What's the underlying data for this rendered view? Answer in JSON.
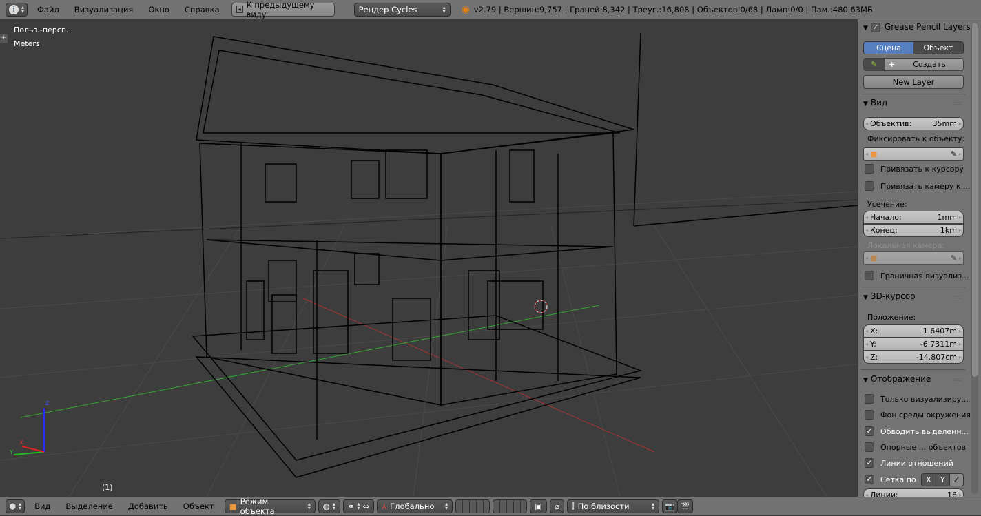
{
  "top": {
    "info_icon": "info-icon",
    "menus": [
      "Файл",
      "Визуализация",
      "Окно",
      "Справка"
    ],
    "back_button": "К предыдущему виду",
    "render_engine": "Рендер Cycles",
    "stats": "v2.79 | Вершин:9,757 | Граней:8,342 | Треуг.:16,808 | Объектов:0/68 | Ламп:0/0 | Пам.:480.63МБ"
  },
  "viewport": {
    "view_name": "Польз.-персп.",
    "units": "Meters",
    "frame": "(1)",
    "axis_x": "X",
    "axis_y": "Y",
    "axis_z": "Z"
  },
  "panel": {
    "grease": {
      "title": "Grease Pencil Layers",
      "tab_scene": "Сцена",
      "tab_object": "Объект",
      "create": "Создать",
      "new_layer": "New Layer"
    },
    "view": {
      "title": "Вид",
      "lens_label": "Объектив:",
      "lens_value": "35mm",
      "lock_label": "Фиксировать к объекту:",
      "lock_cursor": "Привязать к курсору",
      "lock_camera": "Привязать камеру к ...",
      "clip_label": "Усечение:",
      "clip_start_label": "Начало:",
      "clip_start": "1mm",
      "clip_end_label": "Конец:",
      "clip_end": "1km",
      "local_camera": "Локальная камера:",
      "render_border": "Граничная визуализ..."
    },
    "cursor": {
      "title": "3D-курсор",
      "position": "Положение:",
      "x_label": "X:",
      "x": "1.6407m",
      "y_label": "Y:",
      "y": "-6.7311m",
      "z_label": "Z:",
      "z": "-14.807cm"
    },
    "display": {
      "title": "Отображение",
      "only_render": "Только визуализиру...",
      "world_bg": "Фон среды окружения",
      "outline": "Обводить выделенн...",
      "origins": "Опорные ... объектов",
      "relationship": "Линии отношений",
      "grid_floor": "Сетка по",
      "x": "X",
      "y": "Y",
      "z": "Z",
      "lines_label": "Линии:",
      "lines": "16"
    }
  },
  "bottom": {
    "menus": [
      "Вид",
      "Выделение",
      "Добавить",
      "Объект"
    ],
    "mode": "Режим объекта",
    "orientation": "Глобально",
    "snap": "По близости"
  }
}
